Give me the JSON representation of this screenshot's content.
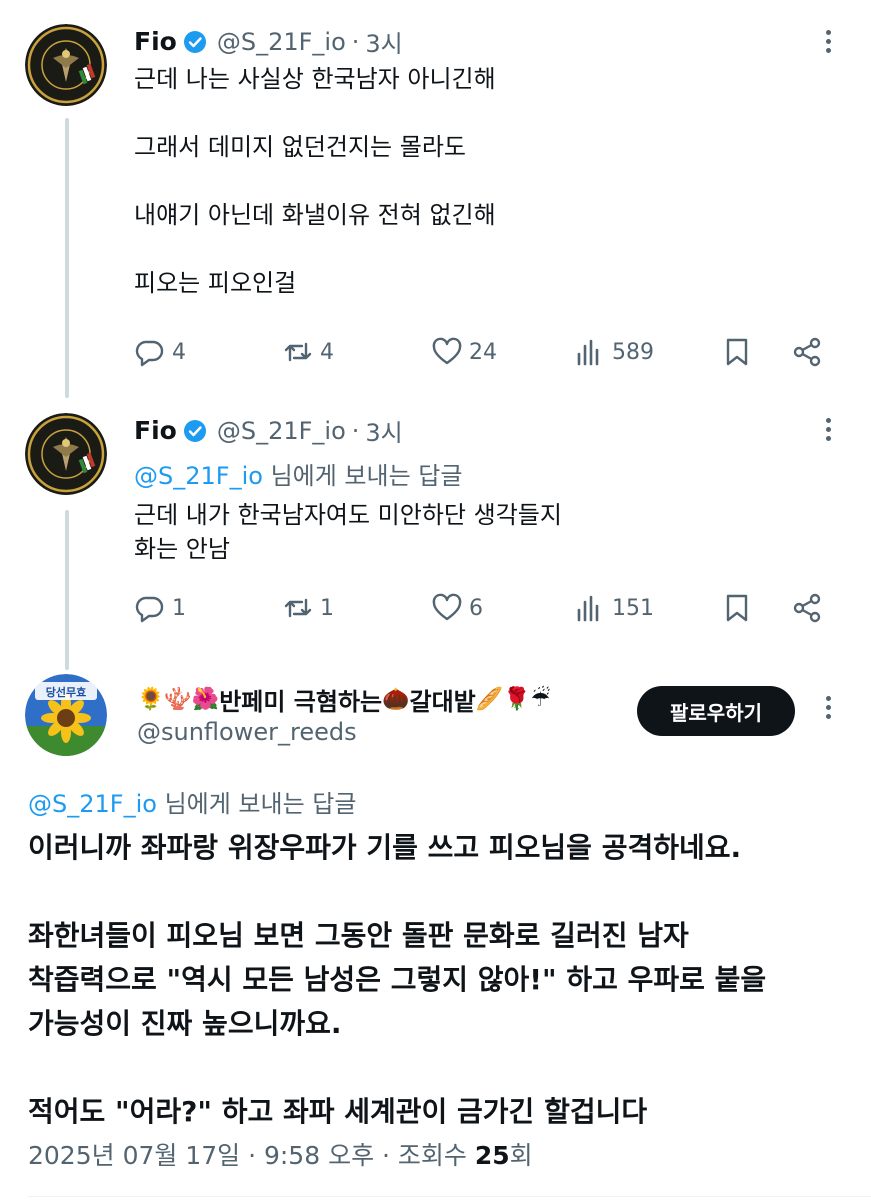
{
  "tweet1": {
    "name": "Fio",
    "handle": "@S_21F_io",
    "dot": "·",
    "time": "3시",
    "text": "근데 나는 사실상 한국남자 아니긴해\n\n그래서 데미지 없던건지는 몰라도\n\n내얘기 아닌데 화낼이유 전혀 없긴해\n\n피오는 피오인걸",
    "replies": "4",
    "retweets": "4",
    "likes": "24",
    "views": "589"
  },
  "tweet2": {
    "name": "Fio",
    "handle": "@S_21F_io",
    "dot": "·",
    "time": "3시",
    "replying_mention": "@S_21F_io",
    "replying_suffix": " 님에게 보내는 답글",
    "text": "근데 내가 한국남자여도 미안하단 생각들지\n화는 안남",
    "replies": "1",
    "retweets": "1",
    "likes": "6",
    "views": "151"
  },
  "tweet3": {
    "avatar_label": "당선무효",
    "name_emoji_prefix": "🌻🪸🌺",
    "name_text1": "반페미 극혐하는",
    "name_emoji_mid": "🌰",
    "name_text2": "갈대밭",
    "name_emoji_suffix": "🥖🌹☔",
    "handle": "@sunflower_reeds",
    "follow_label": "팔로우하기",
    "replying_mention": "@S_21F_io",
    "replying_suffix": " 님에게 보내는 답글",
    "text": "이러니까 좌파랑 위장우파가 기를 쓰고 피오님을 공격하네요.\n\n좌한녀들이 피오님 보면 그동안 돌판 문화로 길러진 남자\n착즙력으로 \"역시 모든 남성은 그렇지 않아!\" 하고 우파로 붙을\n가능성이 진짜 높으니까요.\n\n적어도 \"어라?\" 하고 좌파 세계관이 금가긴 할겁니다",
    "date": "2025년 07월 17일 · 9:58 오후 · 조회수 ",
    "view_count": "25",
    "view_unit": "회"
  },
  "icons": [
    "avatar-badge",
    "verified-icon",
    "more-icon",
    "reply-icon",
    "retweet-icon",
    "like-icon",
    "views-icon",
    "bookmark-icon",
    "share-icon"
  ],
  "colors": {
    "accent": "#1d9bf0",
    "secondary_text": "#536471",
    "thread_line": "#cfd9de"
  }
}
